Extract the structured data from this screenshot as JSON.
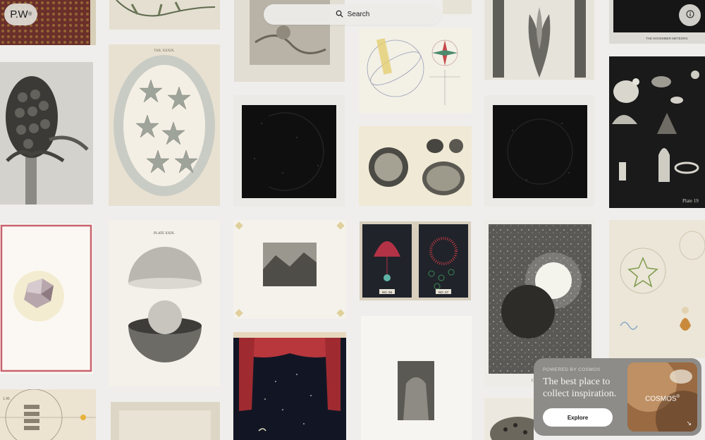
{
  "header": {
    "logo": "P.W",
    "logo_mark": "®",
    "search_label": "Search",
    "search_icon": "search-icon",
    "info_icon": "info-icon"
  },
  "artworks": {
    "pinecone_caption": "",
    "starfish_plate": "TAB. XXXIX.",
    "sphere_plate": "PLATE XXIX.",
    "turkey_plate": "Plate 19",
    "jelly_label_left": "NO. 56",
    "jelly_label_right": "NO. 57",
    "moon_caption": "C'est la lune",
    "night_sky_title": "THE NOVEMBER METEORS",
    "chart_value": "1.45"
  },
  "promo": {
    "powered": "POWERED BY COSMOS",
    "headline": "The best place to collect inspiration.",
    "button": "Explore",
    "brand": "COSMOS",
    "brand_mark": "®",
    "arrow": "↘"
  },
  "colors": {
    "background": "#efeeec",
    "promo_panel": "#8d8c89",
    "button": "#ffffff"
  }
}
